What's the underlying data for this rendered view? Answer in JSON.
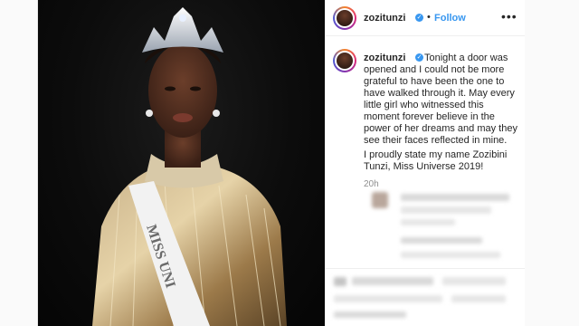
{
  "post": {
    "username": "zozitunzi",
    "follow_label": "Follow",
    "separator": "•",
    "more_label": "•••",
    "verified_glyph": "✓",
    "caption": "Tonight a door was opened and I could not be more grateful to have been the one to have walked through it. May every little girl who witnessed this moment forever believe in the power of her dreams and may they see their faces reflected in mine.",
    "caption_2": "I proudly state my name Zozibini Tunzi, Miss Universe 2019!",
    "time_ago": "20h",
    "sash_text": "MISS UNI"
  },
  "icons": {
    "verified": "verified-badge-icon",
    "more": "more-options-icon"
  },
  "colors": {
    "link_blue": "#3897f0",
    "text": "#262626",
    "muted": "#8e8e8e"
  }
}
